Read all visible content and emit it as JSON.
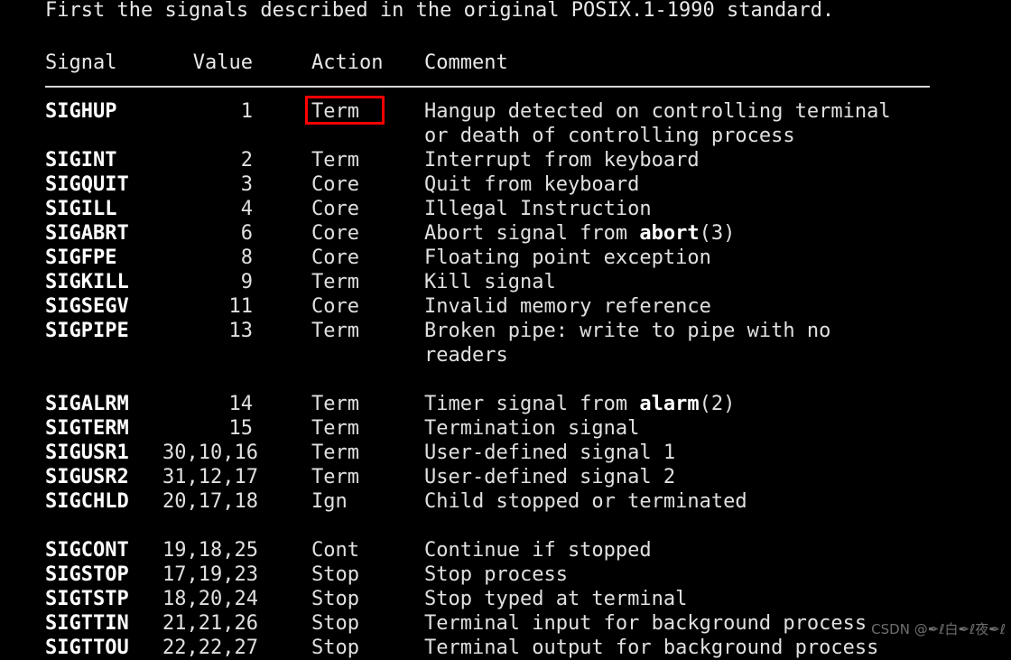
{
  "page": {
    "intro_line": "First the signals described in the original POSIX.1-1990 standard.",
    "background_color": "#000000",
    "text_color": "#e8e8e8",
    "annotation_color": "#ff0000"
  },
  "table": {
    "headers": {
      "signal": "Signal",
      "value": "Value",
      "action": "Action",
      "comment": "Comment"
    },
    "rows": [
      {
        "signal": "SIGHUP",
        "value": "1",
        "action": "Term",
        "comment": "Hangup detected on controlling terminal",
        "comment_cont": "or death of controlling process",
        "highlighted": true
      },
      {
        "signal": "SIGINT",
        "value": "2",
        "action": "Term",
        "comment": "Interrupt from keyboard"
      },
      {
        "signal": "SIGQUIT",
        "value": "3",
        "action": "Core",
        "comment": "Quit from keyboard"
      },
      {
        "signal": "SIGILL",
        "value": "4",
        "action": "Core",
        "comment": "Illegal Instruction"
      },
      {
        "signal": "SIGABRT",
        "value": "6",
        "action": "Core",
        "comment_pre": "Abort signal from ",
        "comment_bold": "abort",
        "comment_post": "(3)"
      },
      {
        "signal": "SIGFPE",
        "value": "8",
        "action": "Core",
        "comment": "Floating point exception"
      },
      {
        "signal": "SIGKILL",
        "value": "9",
        "action": "Term",
        "comment": "Kill signal"
      },
      {
        "signal": "SIGSEGV",
        "value": "11",
        "action": "Core",
        "comment": "Invalid memory reference"
      },
      {
        "signal": "SIGPIPE",
        "value": "13",
        "action": "Term",
        "comment": "Broken pipe: write to pipe with no",
        "comment_cont": "readers"
      },
      {
        "signal": "SIGALRM",
        "value": "14",
        "action": "Term",
        "comment_pre": "Timer signal from ",
        "comment_bold": "alarm",
        "comment_post": "(2)"
      },
      {
        "signal": "SIGTERM",
        "value": "15",
        "action": "Term",
        "comment": "Termination signal"
      },
      {
        "signal": "SIGUSR1",
        "value": "30,10,16",
        "action": "Term",
        "comment": "User-defined signal 1"
      },
      {
        "signal": "SIGUSR2",
        "value": "31,12,17",
        "action": "Term",
        "comment": "User-defined signal 2"
      },
      {
        "signal": "SIGCHLD",
        "value": "20,17,18",
        "action": "Ign",
        "comment": "Child stopped or terminated"
      },
      {
        "signal": "SIGCONT",
        "value": "19,18,25",
        "action": "Cont",
        "comment": "Continue if stopped"
      },
      {
        "signal": "SIGSTOP",
        "value": "17,19,23",
        "action": "Stop",
        "comment": "Stop process"
      },
      {
        "signal": "SIGTSTP",
        "value": "18,20,24",
        "action": "Stop",
        "comment": "Stop typed at terminal"
      },
      {
        "signal": "SIGTTIN",
        "value": "21,21,26",
        "action": "Stop",
        "comment": "Terminal input for background process"
      },
      {
        "signal": "SIGTTOU",
        "value": "22,22,27",
        "action": "Stop",
        "comment": "Terminal output for background process"
      }
    ]
  },
  "watermark": {
    "text": "CSDN @✒ℓ白✒ℓ夜✒ℓ"
  }
}
